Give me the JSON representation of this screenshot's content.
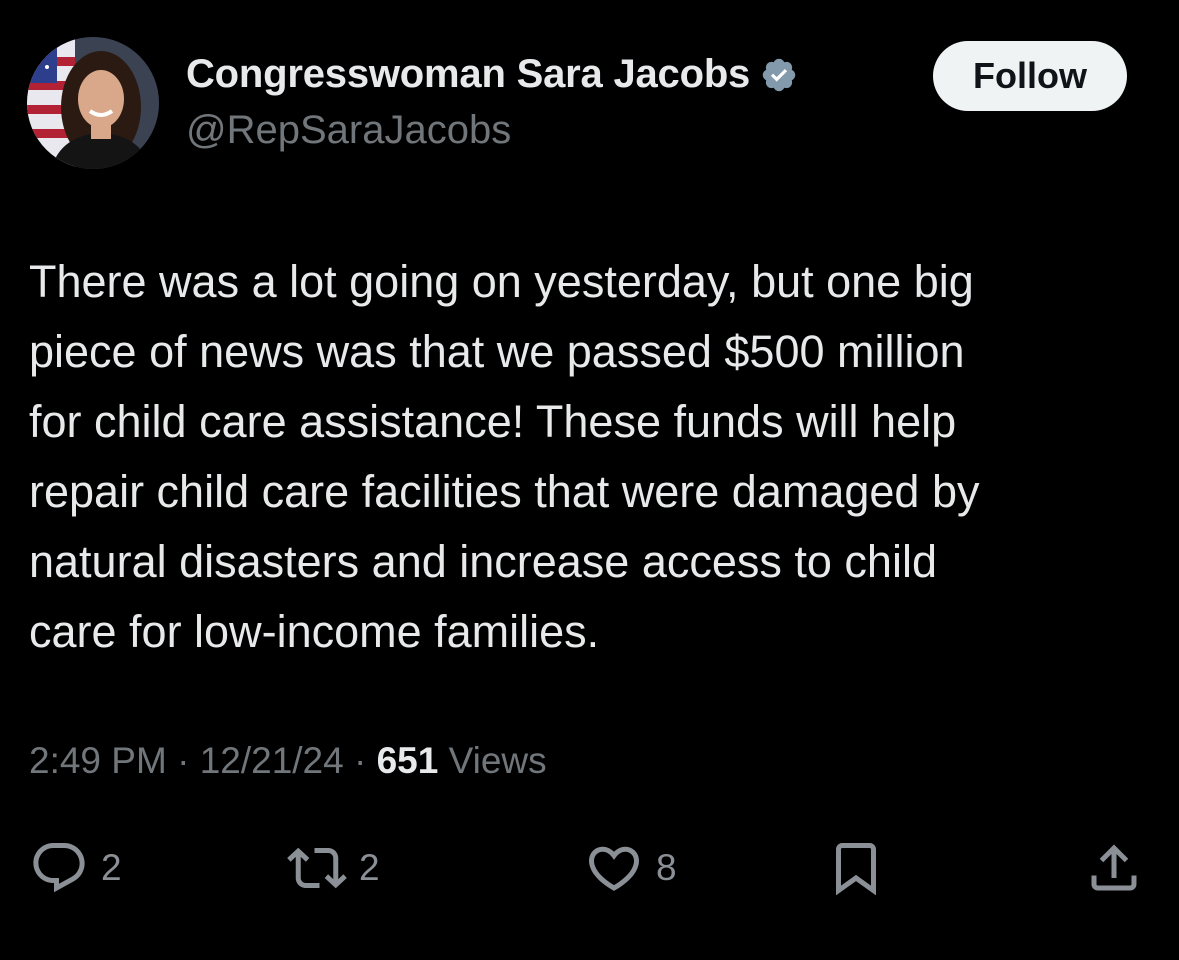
{
  "author": {
    "display_name": "Congresswoman Sara Jacobs",
    "handle": "@RepSaraJacobs",
    "verified": true
  },
  "follow_button": {
    "label": "Follow"
  },
  "tweet": {
    "text_lines": [
      "There was a lot going on yesterday, but one big",
      "piece of news was that we passed $500 million",
      "for child care assistance! These funds will help",
      "repair child care facilities that were damaged by",
      "natural disasters and increase access to child",
      "care for low-income families."
    ]
  },
  "meta": {
    "time": "2:49 PM",
    "date": "12/21/24",
    "separator": " · ",
    "views_count": "651",
    "views_label": " Views"
  },
  "actions": {
    "reply": {
      "icon": "reply-icon",
      "count": "2"
    },
    "retweet": {
      "icon": "retweet-icon",
      "count": "2"
    },
    "like": {
      "icon": "heart-icon",
      "count": "8"
    },
    "bookmark": {
      "icon": "bookmark-icon"
    },
    "share": {
      "icon": "share-icon"
    }
  },
  "colors": {
    "background": "#000000",
    "primary_text": "#e7e9ea",
    "secondary_text": "#71767b",
    "follow_bg": "#eff3f4",
    "verified_badge": "#829aab"
  }
}
